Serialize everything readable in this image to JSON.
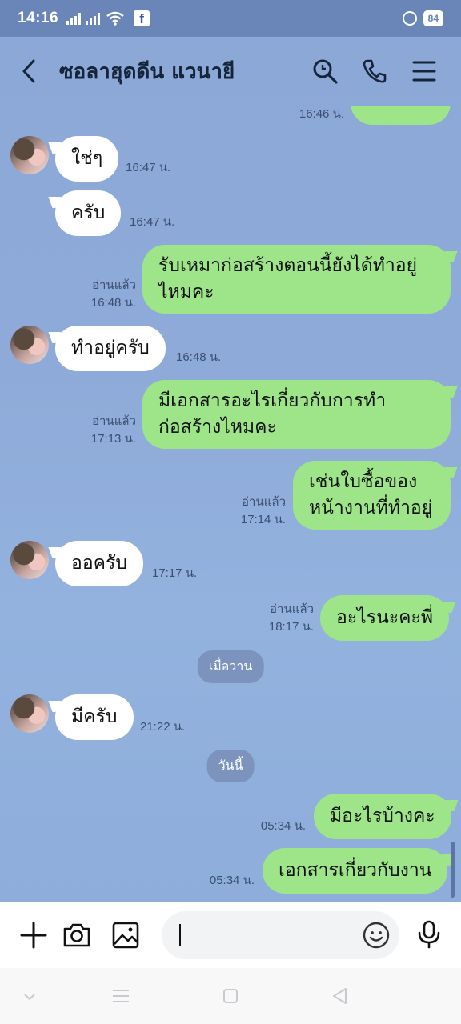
{
  "status": {
    "time": "14:16",
    "battery": "84"
  },
  "header": {
    "title": "ซอลาฮุดดีน แวนายี"
  },
  "messages": [
    {
      "text": "ใช่ๆ",
      "time": "16:47 น."
    },
    {
      "text": "ครับ",
      "time": "16:47 น."
    },
    {
      "line1": "รับเหมาก่อสร้างตอนนี้ยังได้ทำอยู่",
      "line2": "ไหมคะ",
      "read": "อ่านแล้ว",
      "time": "16:48 น."
    },
    {
      "text": "ทำอยู่ครับ",
      "time": "16:48 น."
    },
    {
      "line1": "มีเอกสารอะไรเกี่ยวกับการทำ",
      "line2": "ก่อสร้างไหมคะ",
      "read": "อ่านแล้ว",
      "time": "17:13 น."
    },
    {
      "line1": "เช่นใบซื้อของ",
      "line2": "หน้างานที่ทำอยู่",
      "read": "อ่านแล้ว",
      "time": "17:14 น."
    },
    {
      "text": "ออครับ",
      "time": "17:17 น."
    },
    {
      "text": "อะไรนะคะพี่",
      "read": "อ่านแล้ว",
      "time": "18:17 น."
    },
    {
      "text": "มีครับ",
      "time": "21:22 น."
    },
    {
      "text": "มีอะไรบ้างคะ",
      "time": "05:34 น."
    },
    {
      "text": "เอกสารเกี่ยวกับงาน",
      "time": "05:34 น."
    }
  ],
  "top_partial": {
    "time": "16:46 น."
  },
  "dates": {
    "yesterday": "เมื่อวาน",
    "today": "วันนี้"
  },
  "icons": {
    "back": "chevron-left-icon",
    "search": "search-icon",
    "call": "phone-icon",
    "menu": "menu-icon",
    "plus": "plus-icon",
    "camera": "camera-icon",
    "image": "image-icon",
    "emoji": "emoji-icon",
    "mic": "mic-icon"
  },
  "colors": {
    "outgoing": "#9ee488",
    "incoming": "#ffffff",
    "background": "#8ba8d6"
  }
}
